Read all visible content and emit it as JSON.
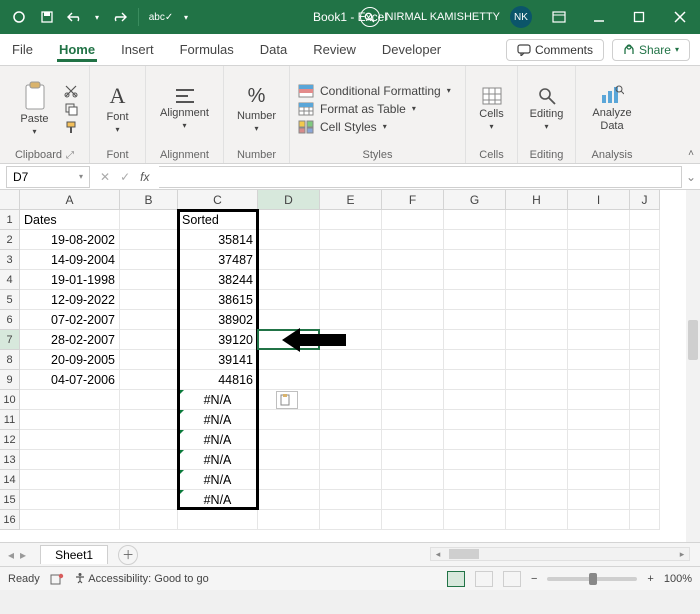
{
  "title": {
    "doc": "Book1",
    "app": "Excel",
    "combined": "Book1  -  Excel"
  },
  "user": {
    "name": "NIRMAL KAMISHETTY",
    "initials": "NK"
  },
  "qat": {
    "autosave_off": "●",
    "save": "💾",
    "undo": "↶",
    "redo": "↷",
    "spell": "abc✓"
  },
  "tabs": {
    "file": "File",
    "home": "Home",
    "insert": "Insert",
    "formulas": "Formulas",
    "data": "Data",
    "review": "Review",
    "developer": "Developer",
    "comments": "Comments",
    "share": "Share"
  },
  "ribbon": {
    "clipboard": {
      "paste": "Paste",
      "label": "Clipboard"
    },
    "font": {
      "btn": "Font",
      "label": "Font"
    },
    "alignment": {
      "btn": "Alignment",
      "label": "Alignment"
    },
    "number": {
      "btn": "Number",
      "label": "Number"
    },
    "styles": {
      "cf": "Conditional Formatting",
      "fat": "Format as Table",
      "cs": "Cell Styles",
      "label": "Styles"
    },
    "cells": {
      "btn": "Cells",
      "label": "Cells"
    },
    "editing": {
      "btn": "Editing",
      "label": "Editing"
    },
    "analysis": {
      "btn": "Analyze Data",
      "label": "Analysis"
    }
  },
  "namebox": "D7",
  "formula": "",
  "columns": [
    "A",
    "B",
    "C",
    "D",
    "E",
    "F",
    "G",
    "H",
    "I",
    "J"
  ],
  "rows": [
    1,
    2,
    3,
    4,
    5,
    6,
    7,
    8,
    9,
    10,
    11,
    12,
    13,
    14,
    15,
    16
  ],
  "selected": {
    "col": "D",
    "row": 7
  },
  "data": {
    "A": {
      "1": "Dates",
      "2": "19-08-2002",
      "3": "14-09-2004",
      "4": "19-01-1998",
      "5": "12-09-2022",
      "6": "07-02-2007",
      "7": "28-02-2007",
      "8": "20-09-2005",
      "9": "04-07-2006"
    },
    "C": {
      "1": "Sorted",
      "2": "35814",
      "3": "37487",
      "4": "38244",
      "5": "38615",
      "6": "38902",
      "7": "39120",
      "8": "39141",
      "9": "44816",
      "10": "#N/A",
      "11": "#N/A",
      "12": "#N/A",
      "13": "#N/A",
      "14": "#N/A",
      "15": "#N/A"
    }
  },
  "sheet": {
    "name": "Sheet1"
  },
  "status": {
    "ready": "Ready",
    "access": "Accessibility: Good to go",
    "zoom": "100%"
  }
}
